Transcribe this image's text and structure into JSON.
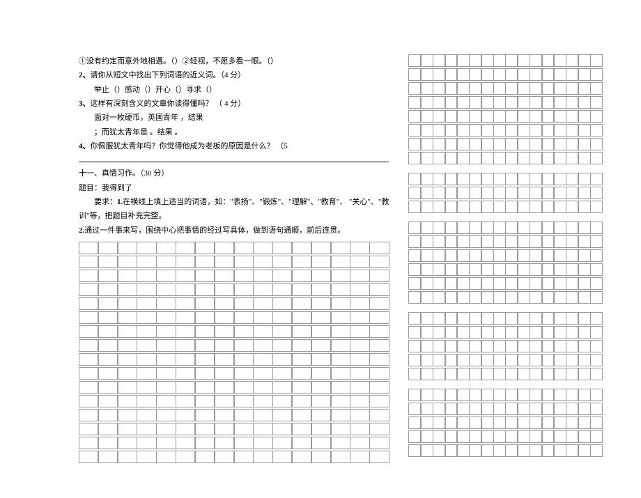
{
  "left": {
    "lines": [
      {
        "cls": "text-line",
        "text": "①没有约定而意外地相遇。（）②轻视，不愿多看一眼。（）"
      },
      {
        "cls": "text-line",
        "html": [
          {
            "cls": "num",
            "bind": "left.q2.num"
          },
          {
            "bind": "left.q2.text"
          }
        ]
      },
      {
        "cls": "text-line indent",
        "text": "举止（）感动（）开心（）寻求（）"
      },
      {
        "cls": "text-line",
        "html": [
          {
            "cls": "num",
            "bind": "left.q3.num"
          },
          {
            "bind": "left.q3.text"
          }
        ]
      },
      {
        "cls": "text-line indent",
        "text": "面对一枚硬币，英国青年 ，结果"
      },
      {
        "cls": "text-line indent",
        "text": "；而犹太青年是 。结果 。"
      },
      {
        "cls": "text-line",
        "html": [
          {
            "cls": "num",
            "bind": "left.q4.num"
          },
          {
            "bind": "left.q4.text"
          }
        ]
      }
    ],
    "q2": {
      "num": "2、",
      "text": "请你从短文中找出下列词语的近义词。（4 分）"
    },
    "q3": {
      "num": "3、",
      "text": "这样有深刻含义的文章你读得懂吗？ （ 4 分）"
    },
    "q4": {
      "num": "4、",
      "text": "你佩服犹太青年吗？你觉得他成为老板的原因是什么？ （5"
    },
    "section": {
      "heading": "十一、真情习作。（30 分）",
      "topic": "题目：我得到了",
      "req_label": "要求：",
      "req1_num": "1.",
      "req1": "在横线上填上适当的词语，如：\"表扬\"、\"锻炼\"、\"理解\"、\"教育\"、 \"关心\"、\"教",
      "req1b": "训\"等，把题目补充完整。",
      "req2_num": "2.",
      "req2": "通过一件事来写，围绕中心把事情的经过写具体，做到语句通顺，前后连贯。"
    },
    "gridRows": 16,
    "gridCols": 16
  },
  "right": {
    "groups": [
      {
        "rows": 8
      },
      {
        "rows": 3
      },
      {
        "rows": 6
      },
      {
        "rows": 5
      },
      {
        "rows": 5
      }
    ],
    "cols": 16
  }
}
